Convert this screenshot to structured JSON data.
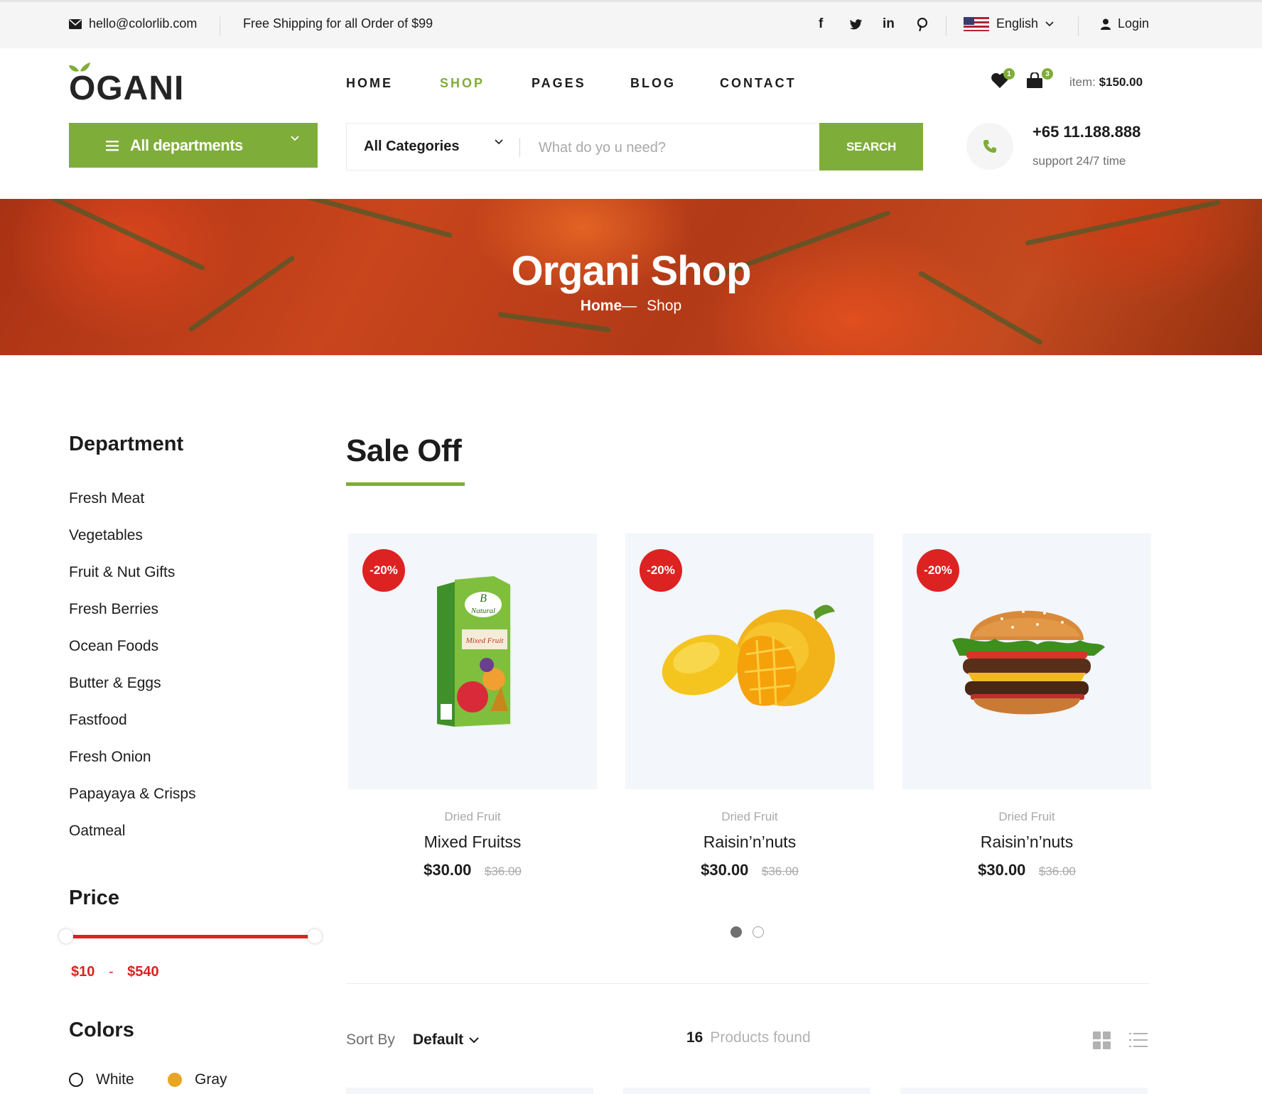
{
  "topbar": {
    "email": "hello@colorlib.com",
    "shipping": "Free Shipping for all Order of $99",
    "social": [
      "facebook-icon",
      "twitter-icon",
      "linkedin-icon",
      "pinterest-icon"
    ],
    "language": "English",
    "login": "Login"
  },
  "header": {
    "logo_text": "OGANI",
    "nav": [
      "HOME",
      "SHOP",
      "PAGES",
      "BLOG",
      "CONTACT"
    ],
    "active_nav": "SHOP",
    "wishlist_count": "1",
    "cart_count": "3",
    "cart_label": "item:",
    "cart_total": "$150.00"
  },
  "search": {
    "departments": "All departments",
    "category": "All Categories",
    "placeholder": "What do yo u need?",
    "button": "SEARCH",
    "phone": "+65 11.188.888",
    "support": "support 24/7 time"
  },
  "hero": {
    "title": "Organi Shop",
    "crumb_home": "Home",
    "crumb_sep": "—",
    "crumb_current": "Shop"
  },
  "sidebar": {
    "department_title": "Department",
    "departments": [
      "Fresh Meat",
      "Vegetables",
      "Fruit & Nut Gifts",
      "Fresh Berries",
      "Ocean Foods",
      "Butter & Eggs",
      "Fastfood",
      "Fresh Onion",
      "Papayaya & Crisps",
      "Oatmeal"
    ],
    "price_title": "Price",
    "price_min": "$10",
    "price_dash": "-",
    "price_max": "$540",
    "colors_title": "Colors",
    "colors": [
      {
        "name": "White",
        "color": "#ffffff"
      },
      {
        "name": "Gray",
        "color": "#e9a625"
      }
    ]
  },
  "sale": {
    "title": "Sale Off",
    "products": [
      {
        "discount": "-20%",
        "category": "Dried Fruit",
        "name": "Mixed Fruitss",
        "price": "$30.00",
        "old_price": "$36.00",
        "image": "juice-carton"
      },
      {
        "discount": "-20%",
        "category": "Dried Fruit",
        "name": "Raisin’n’nuts",
        "price": "$30.00",
        "old_price": "$36.00",
        "image": "mango"
      },
      {
        "discount": "-20%",
        "category": "Dried Fruit",
        "name": "Raisin’n’nuts",
        "price": "$30.00",
        "old_price": "$36.00",
        "image": "burger"
      }
    ],
    "pages": 2,
    "active_page": 1
  },
  "sort": {
    "label": "Sort By",
    "value": "Default",
    "count": "16",
    "found_label": "Products found"
  },
  "colors": {
    "accent": "#7fad39",
    "sale_red": "#dd2222",
    "text": "#1c1c1c",
    "muted": "#6f6f6f",
    "card_bg": "#f3f6fa"
  }
}
